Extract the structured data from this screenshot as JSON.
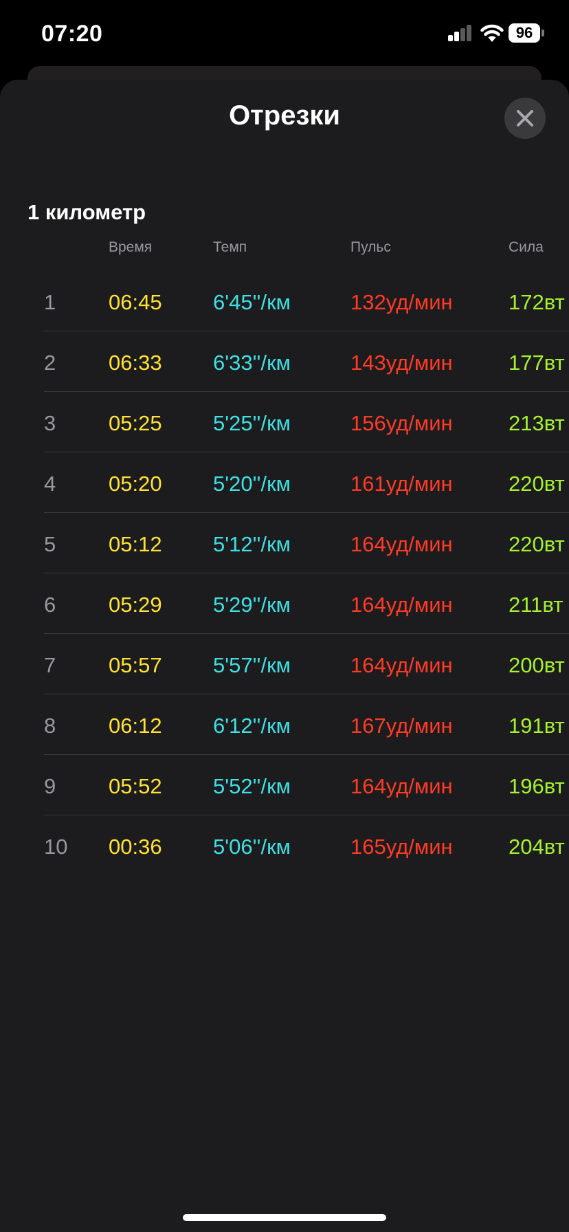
{
  "status_bar": {
    "time": "07:20",
    "battery": "96"
  },
  "sheet": {
    "title": "Отрезки",
    "section_title": "1 километр",
    "columns": {
      "time": "Время",
      "pace": "Темп",
      "hr": "Пульс",
      "power": "Сила"
    },
    "rows": [
      {
        "num": "1",
        "time": "06:45",
        "pace": "6'45''/км",
        "hr": "132уд/мин",
        "power": "172вт"
      },
      {
        "num": "2",
        "time": "06:33",
        "pace": "6'33''/км",
        "hr": "143уд/мин",
        "power": "177вт"
      },
      {
        "num": "3",
        "time": "05:25",
        "pace": "5'25''/км",
        "hr": "156уд/мин",
        "power": "213вт"
      },
      {
        "num": "4",
        "time": "05:20",
        "pace": "5'20''/км",
        "hr": "161уд/мин",
        "power": "220вт"
      },
      {
        "num": "5",
        "time": "05:12",
        "pace": "5'12''/км",
        "hr": "164уд/мин",
        "power": "220вт"
      },
      {
        "num": "6",
        "time": "05:29",
        "pace": "5'29''/км",
        "hr": "164уд/мин",
        "power": "211вт"
      },
      {
        "num": "7",
        "time": "05:57",
        "pace": "5'57''/км",
        "hr": "164уд/мин",
        "power": "200вт"
      },
      {
        "num": "8",
        "time": "06:12",
        "pace": "6'12''/км",
        "hr": "167уд/мин",
        "power": "191вт"
      },
      {
        "num": "9",
        "time": "05:52",
        "pace": "5'52''/км",
        "hr": "164уд/мин",
        "power": "196вт"
      },
      {
        "num": "10",
        "time": "00:36",
        "pace": "5'06''/км",
        "hr": "165уд/мин",
        "power": "204вт"
      }
    ]
  },
  "colors": {
    "time": "#ffe234",
    "pace": "#3fe0e3",
    "heart_rate": "#ff3b25",
    "power": "#a6f12f"
  },
  "icons": [
    "cellular-signal-icon",
    "wifi-icon",
    "battery-icon",
    "close-icon"
  ]
}
